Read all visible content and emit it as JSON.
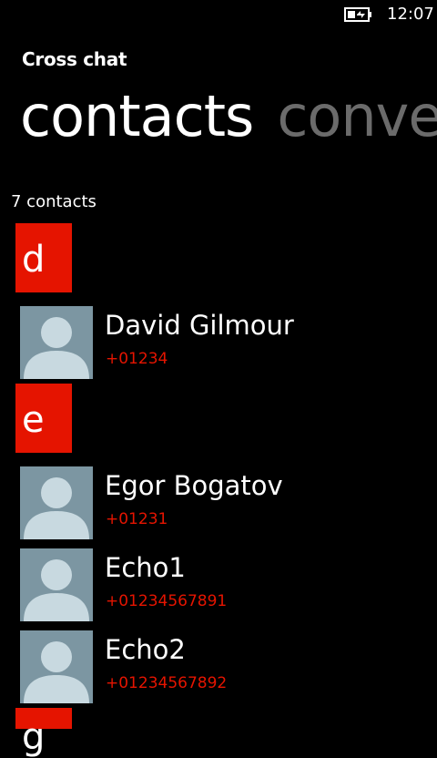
{
  "status_bar": {
    "time": "12:07",
    "battery_icon": "battery-charging-icon"
  },
  "app": {
    "title": "Cross chat"
  },
  "pivot": {
    "items": [
      {
        "label": "contacts",
        "active": true
      },
      {
        "label": "conve",
        "active": false
      }
    ]
  },
  "contacts_count": "7 contacts",
  "groups": [
    {
      "letter": "d"
    },
    {
      "letter": "e"
    },
    {
      "letter": "g"
    }
  ],
  "contacts": [
    {
      "name": "David Gilmour",
      "phone": "+01234",
      "avatar_icon": "person-silhouette-icon"
    },
    {
      "name": "Egor Bogatov",
      "phone": "+01231",
      "avatar_icon": "person-silhouette-icon"
    },
    {
      "name": "Echo1",
      "phone": "+01234567891",
      "avatar_icon": "person-silhouette-icon"
    },
    {
      "name": "Echo2",
      "phone": "+01234567892",
      "avatar_icon": "person-silhouette-icon"
    }
  ],
  "colors": {
    "accent": "#e51400",
    "background": "#000000",
    "avatar_bg": "#7c96a2",
    "avatar_fg": "#c8d9e0",
    "pivot_inactive": "#6b6b6b"
  }
}
